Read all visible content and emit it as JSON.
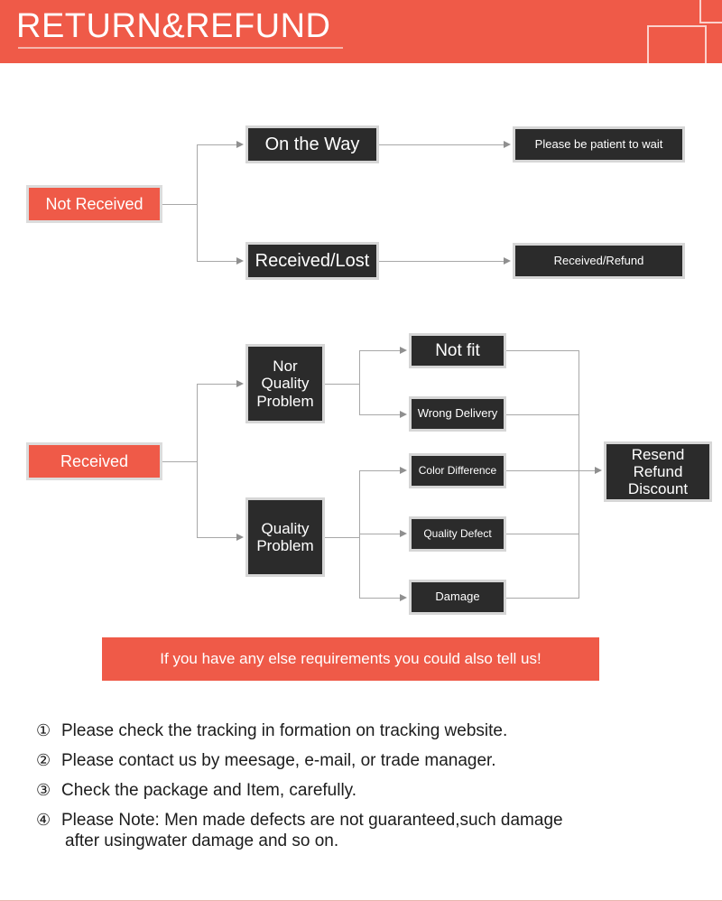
{
  "header": {
    "title": "RETURN&REFUND",
    "accent_color": "#ef5a48",
    "decor": [
      "square-outline-top",
      "square-outline-bottom"
    ]
  },
  "flow_not_received": {
    "root": "Not Received",
    "branches": [
      {
        "stage": "On the Way",
        "result": "Please be patient to wait"
      },
      {
        "stage": "Received/Lost",
        "result": "Received/Refund"
      }
    ]
  },
  "flow_received": {
    "root": "Received",
    "groups": [
      {
        "name": "Nor\nQuality\nProblem",
        "line1": "Nor",
        "line2": "Quality",
        "line3": "Problem",
        "reasons": [
          "Not fit",
          "Wrong Delivery"
        ]
      },
      {
        "name": "Quality\nProblem",
        "line1": "Quality",
        "line2": "Problem",
        "reasons": [
          "Color Difference",
          "Quality Defect",
          "Damage"
        ]
      }
    ],
    "outcome": {
      "line1": "Resend",
      "line2": "Refund",
      "line3": "Discount"
    }
  },
  "notice": {
    "text": "If you have any else requirements you could also tell us!"
  },
  "notes": [
    {
      "num": "①",
      "text": "Please check the tracking in formation on tracking website.",
      "cont": ""
    },
    {
      "num": "②",
      "text": "Please contact us by meesage, e-mail, or trade manager.",
      "cont": ""
    },
    {
      "num": "③",
      "text": "Check the package and Item, carefully.",
      "cont": ""
    },
    {
      "num": "④",
      "text": "Please Note: Men made defects are not guaranteed,such damage",
      "cont": "after usingwater damage and so on."
    }
  ]
}
